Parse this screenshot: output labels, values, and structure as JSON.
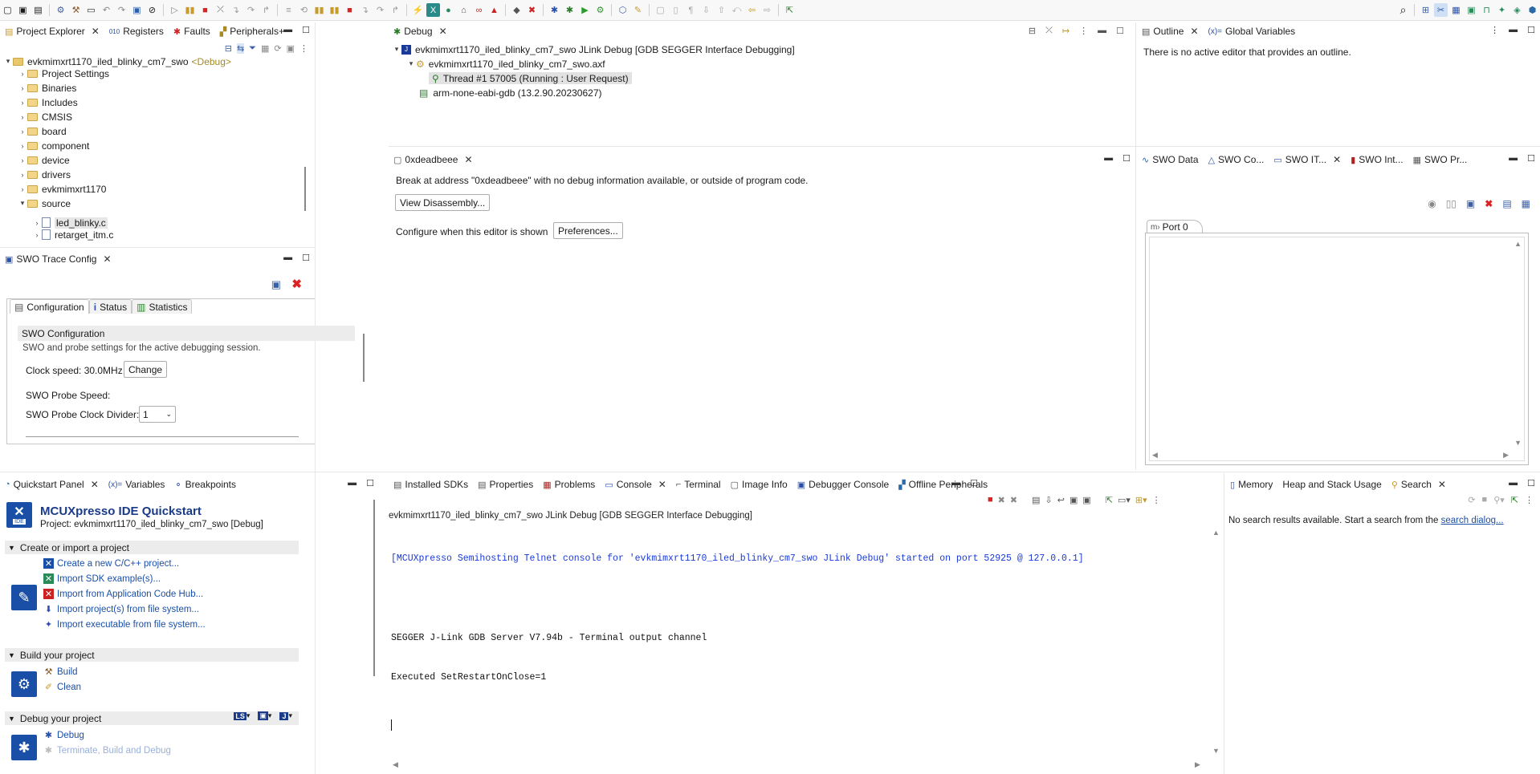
{
  "project_explorer": {
    "tabs": [
      "Project Explorer",
      "Registers",
      "Faults",
      "Peripherals+"
    ],
    "root": {
      "name": "evkmimxrt1170_iled_blinky_cm7_swo",
      "badge": "<Debug>"
    },
    "items": [
      "Project Settings",
      "Binaries",
      "Includes",
      "CMSIS",
      "board",
      "component",
      "device",
      "drivers",
      "evkmimxrt1170",
      "source"
    ],
    "source_children": [
      "led_blinky.c",
      "retarget_itm.c"
    ]
  },
  "swo_trace": {
    "tab": "SWO Trace Config",
    "subtabs": [
      "Configuration",
      "Status",
      "Statistics"
    ],
    "section_title": "SWO Configuration",
    "section_desc": "SWO and probe settings for the active debugging session.",
    "clock_speed_label": "Clock speed: 30.0MHz",
    "change_label": "Change",
    "probe_speed_label": "SWO Probe Speed:",
    "divider_label": "SWO Probe Clock Divider:",
    "divider_value": "1"
  },
  "debug": {
    "tab": "Debug",
    "launch": "evkmimxrt1170_iled_blinky_cm7_swo JLink Debug [GDB SEGGER Interface Debugging]",
    "axf": "evkmimxrt1170_iled_blinky_cm7_swo.axf",
    "thread": "Thread #1 57005 (Running : User Request)",
    "gdb": "arm-none-eabi-gdb (13.2.90.20230627)"
  },
  "editor": {
    "tab": "0xdeadbeee",
    "message": "Break at address \"0xdeadbeee\" with no debug information available, or outside of program code.",
    "view_disassembly": "View Disassembly...",
    "configure_label": "Configure when this editor is shown",
    "preferences": "Preferences..."
  },
  "outline": {
    "tabs": [
      "Outline",
      "Global Variables"
    ],
    "message": "There is no active editor that provides an outline."
  },
  "swo_views": {
    "tabs": [
      "SWO Data",
      "SWO Co...",
      "SWO IT...",
      "SWO Int...",
      "SWO Pr..."
    ],
    "port_tab": "Port 0"
  },
  "quickstart": {
    "tabs": [
      "Quickstart Panel",
      "Variables",
      "Breakpoints"
    ],
    "title": "MCUXpresso IDE Quickstart",
    "project": "Project: evkmimxrt1170_iled_blinky_cm7_swo [Debug]",
    "ide_label": "IDE",
    "sections": [
      {
        "title": "Create or import a project",
        "links": [
          "Create a new C/C++ project...",
          "Import SDK example(s)...",
          "Import from Application Code Hub...",
          "Import project(s) from file system...",
          "Import executable from file system..."
        ]
      },
      {
        "title": "Build your project",
        "links": [
          "Build",
          "Clean"
        ]
      },
      {
        "title": "Debug your project",
        "links": [
          "Debug",
          "Terminate, Build and Debug"
        ]
      }
    ],
    "debug_badges": [
      "LS",
      "J"
    ]
  },
  "console": {
    "tabs": [
      "Installed SDKs",
      "Properties",
      "Problems",
      "Console",
      "Terminal",
      "Image Info",
      "Debugger Console",
      "Offline Peripherals"
    ],
    "header": "evkmimxrt1170_iled_blinky_cm7_swo JLink Debug [GDB SEGGER Interface Debugging]",
    "lines": [
      "[MCUXpresso Semihosting Telnet console for 'evkmimxrt1170_iled_blinky_cm7_swo JLink Debug' started on port 52925 @ 127.0.0.1]",
      "",
      "SEGGER J-Link GDB Server V7.94b - Terminal output channel",
      "Executed SetRestartOnClose=1"
    ]
  },
  "memory": {
    "tabs": [
      "Memory",
      "Heap and Stack Usage",
      "Search"
    ],
    "message": "No search results available. Start a search from the ",
    "link": "search dialog..."
  }
}
